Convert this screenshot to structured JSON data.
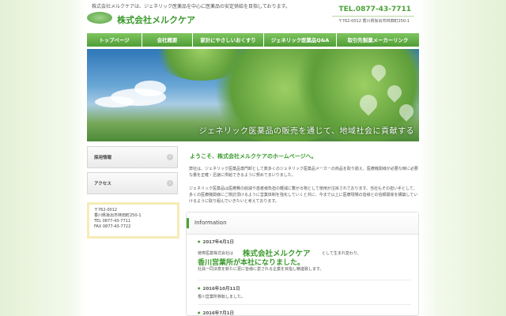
{
  "header": {
    "tagline": "株式会社メルクケアは、ジェネリック医薬品を中心に医薬品の安定供給を目指しております。",
    "company": "株式会社メルクケア",
    "tel": "TEL.0877-43-7711",
    "address": "〒762-0012 香川県坂出市林田町250-1"
  },
  "nav": [
    "トップページ",
    "会社概要",
    "家計にやさしいおくすり",
    "ジェネリック医薬品Q&A",
    "取引先製薬メーカーリンク"
  ],
  "hero": {
    "text": "ジェネリック医薬品の販売を通じて、地域社会に貢献する"
  },
  "sidebar": {
    "items": [
      "採用情報",
      "アクセス"
    ],
    "address_lines": [
      "〒762-0012",
      "香川県坂出市林田町250-1",
      "TEL 0877-43-7711",
      "FAX 0877-43-7722"
    ]
  },
  "main": {
    "welcome": "ようこそ、株式会社メルクケアのホームページへ。",
    "paragraph1": "弊社は、ジェネリック医薬品専門卸として数多くのジェネリック医薬品メーカーの商品を取り揃え、医療機関様が必要な時に必要な量を正確・迅速に供給できるように努めてまいりました。",
    "paragraph2": "ジェネリック医薬品は医療費の削減や患者様負担の軽減に繋がる物として使用が注目されております。当社もその担い手として、多くの医療機関様にご検討頂けるように営業体制を強化していくと共に、今まで以上に医療現場の皆様との信頼関係を構築していけるように取り組んでいきたいと考えております。"
  },
  "info": {
    "title": "Information",
    "items": [
      {
        "date": "2017年4月1日",
        "prefix": "徳寿医薬株式会社は",
        "highlight1": "株式会社メルクケア",
        "suffix": "として生まれ変わり、",
        "highlight2": "香川営業所が本社になりました。",
        "note": "社員一同決意を新たに更に皆様に愛される企業を目指し精進致します。"
      },
      {
        "date": "2016年10月11日",
        "note": "香川営業所移転しました。"
      },
      {
        "date": "2016年7月1日"
      }
    ]
  }
}
